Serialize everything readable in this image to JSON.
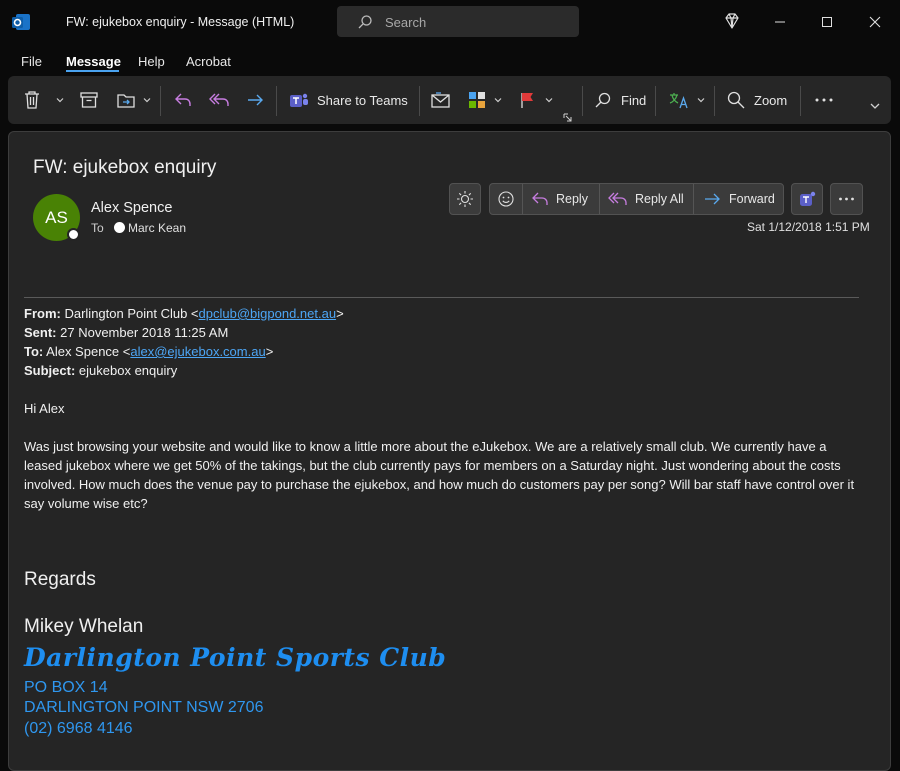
{
  "window": {
    "title": "FW: ejukebox enquiry  -  Message (HTML)",
    "app_icon": "outlook-icon",
    "search_placeholder": "Search"
  },
  "menu": {
    "items": [
      "File",
      "Message",
      "Help",
      "Acrobat"
    ],
    "active": "Message"
  },
  "ribbon": {
    "share_to_teams": "Share to Teams",
    "find": "Find",
    "zoom": "Zoom",
    "more": "..."
  },
  "message": {
    "subject": "FW: ejukebox enquiry",
    "avatar_initials": "AS",
    "sender": "Alex Spence",
    "to_label": "To",
    "recipient": "Marc Kean",
    "date": "Sat 1/12/2018 1:51 PM",
    "actions": {
      "reply": "Reply",
      "reply_all": "Reply All",
      "forward": "Forward"
    }
  },
  "body": {
    "from_label": "From:",
    "from_name": "Darlington Point Club <",
    "from_email": "dpclub@bigpond.net.au",
    "from_close": ">",
    "sent_label": "Sent:",
    "sent_value": "27 November 2018 11:25 AM",
    "to_label": "To:",
    "to_name": "Alex Spence <",
    "to_email": "alex@ejukebox.com.au",
    "to_close": ">",
    "subject_label": "Subject:",
    "subject_value": "ejukebox enquiry",
    "greeting": "Hi Alex",
    "paragraph": "Was just browsing your website and would like to know a little more about the eJukebox. We are a relatively small club. We currently have a leased jukebox where we get 50% of the takings, but the club currently pays for members on a Saturday night.  Just wondering about the costs involved. How much does the venue pay to purchase the ejukebox, and how much do customers pay per song? Will bar staff have control over it say volume wise etc?",
    "regards": "Regards",
    "signature_name": "Mikey Whelan",
    "club_name": "Darlington Point Sports Club",
    "address_line1": "PO BOX 14",
    "address_line2": "DARLINGTON POINT NSW 2706",
    "phone": "(02) 6968 4146"
  },
  "colors": {
    "accent": "#4aa3f0",
    "avatar_bg": "#498205",
    "link": "#4da6f5",
    "signature_blue": "#1e8ef0"
  }
}
